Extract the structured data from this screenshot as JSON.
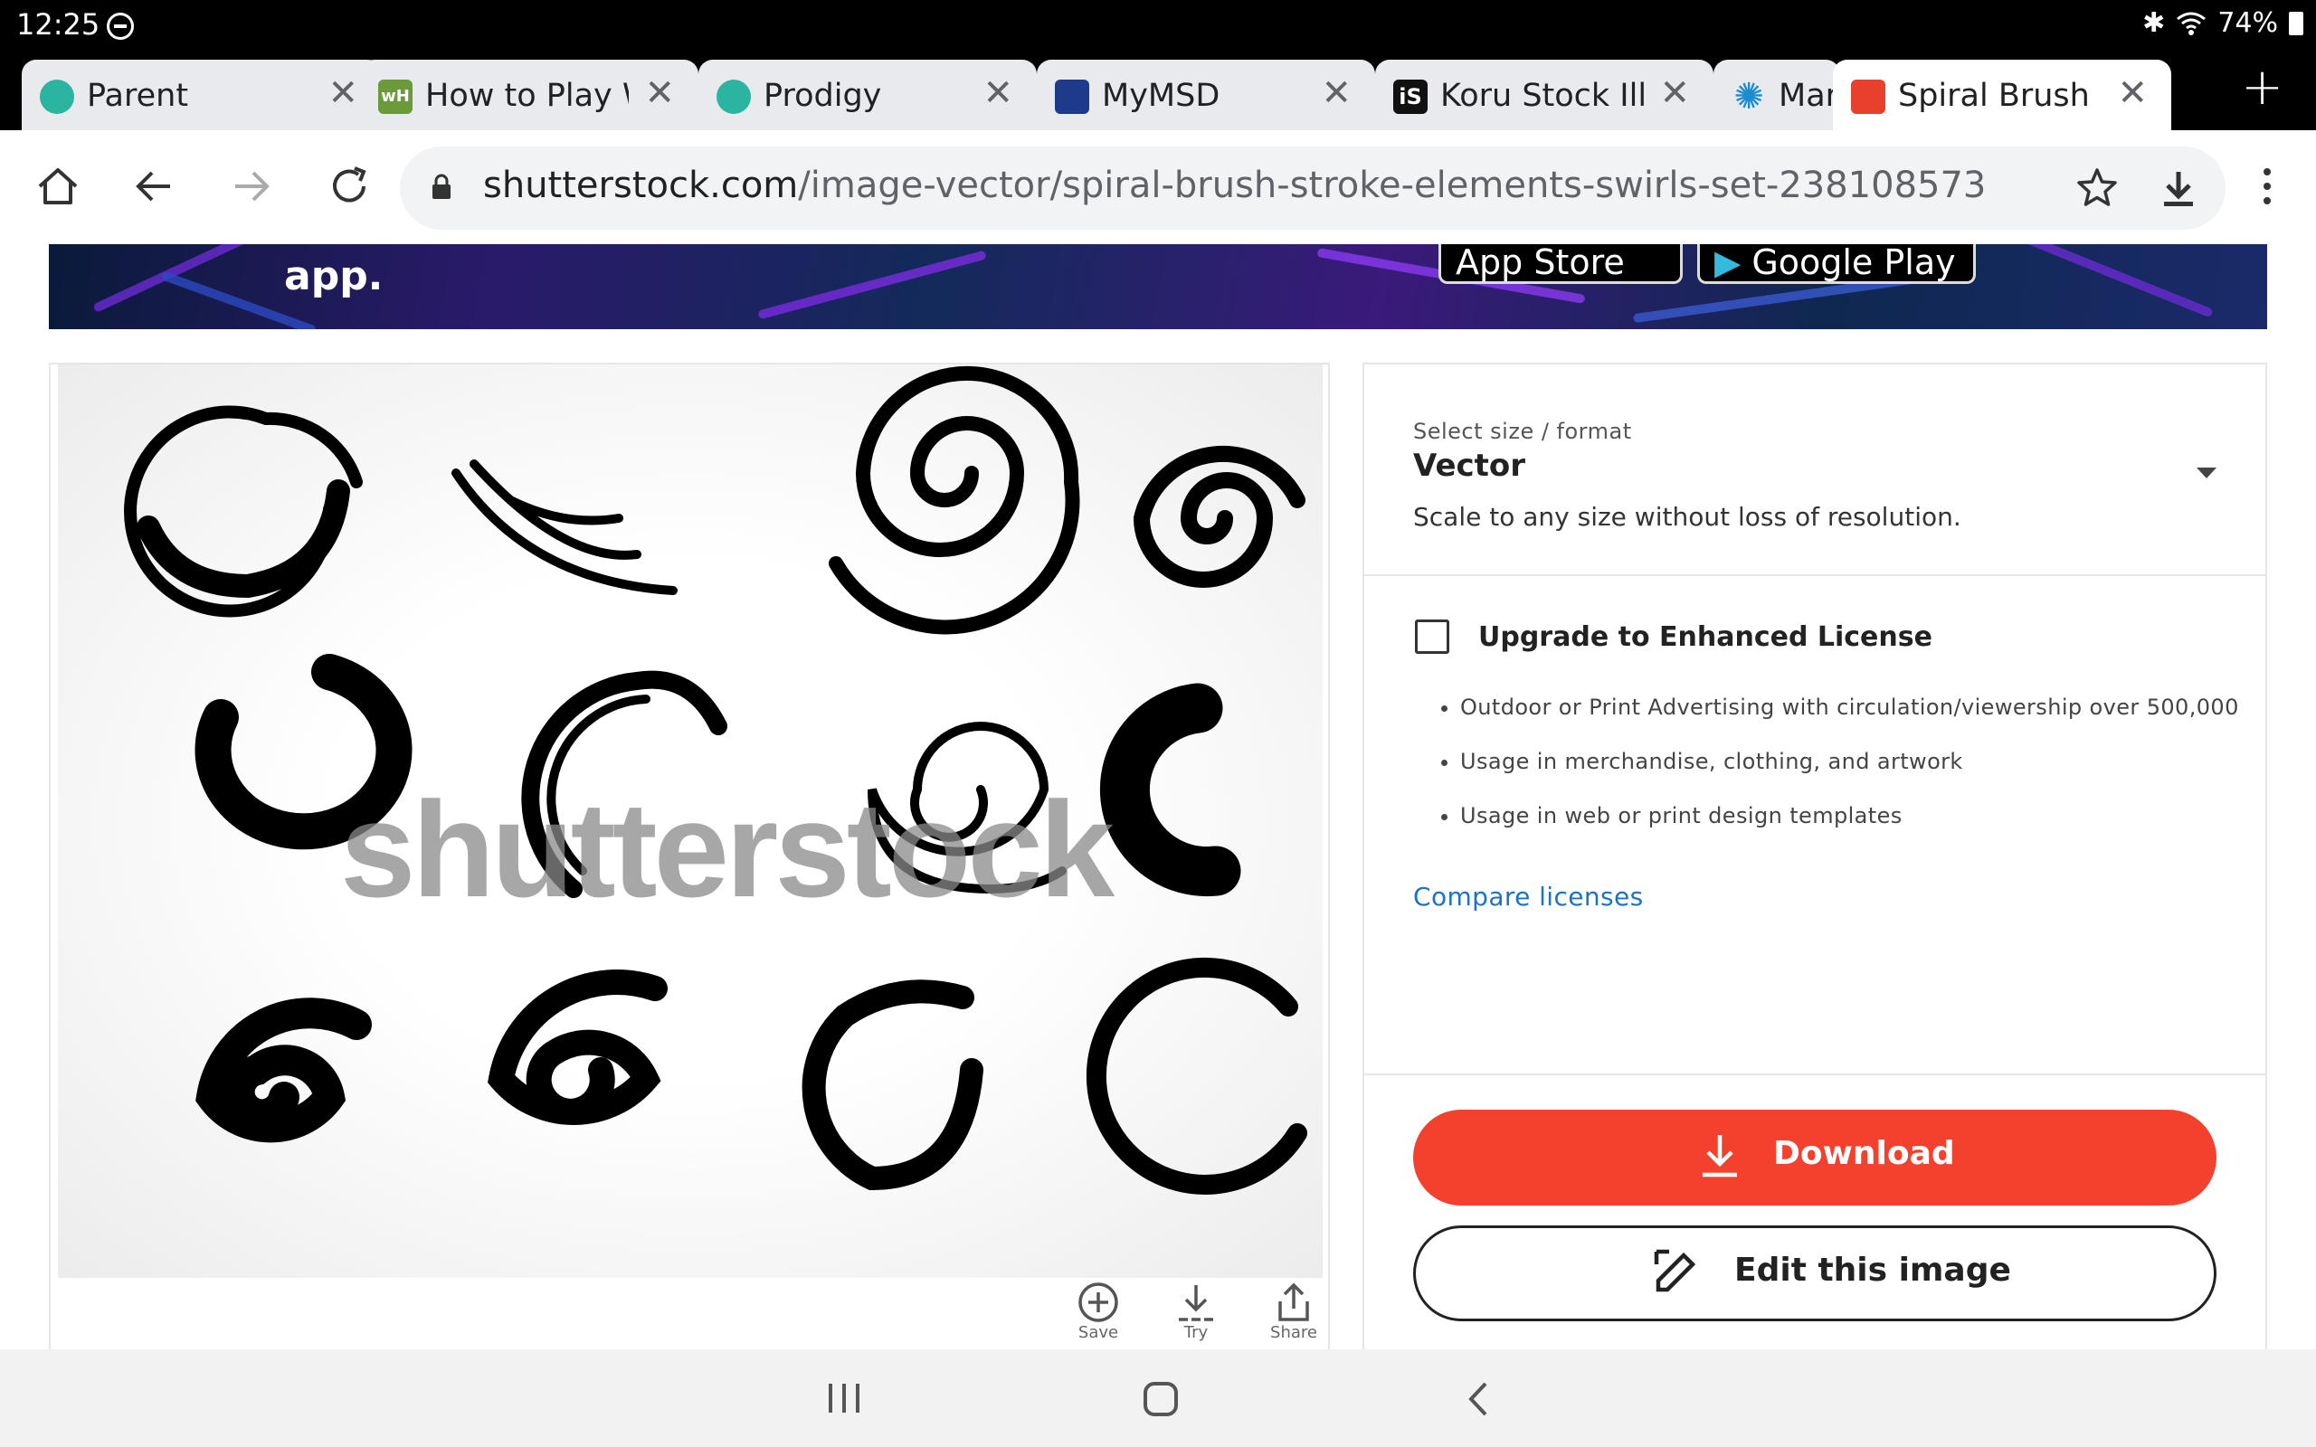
{
  "status_bar": {
    "time": "12:25",
    "battery": "74%"
  },
  "tabs": [
    {
      "title": "Parent",
      "favicon": "frog-icon",
      "color": "#2bb5a0"
    },
    {
      "title": "How to Play Wi",
      "favicon": "wh-icon",
      "color": "#6a9a3a"
    },
    {
      "title": "Prodigy",
      "favicon": "frog-icon",
      "color": "#2bb5a0"
    },
    {
      "title": "MyMSD",
      "favicon": "mymsd-icon",
      "color": "#1e3a8a"
    },
    {
      "title": "Koru Stock Illus",
      "favicon": "istock-icon",
      "color": "#111111"
    },
    {
      "title": "Mar",
      "favicon": "splash-icon",
      "color": "#1a8ccf"
    },
    {
      "title": "Spiral Brush St",
      "favicon": "shutterstock-icon",
      "color": "#e8402c"
    }
  ],
  "address_bar": {
    "domain": "shutterstock.com",
    "path": "/image-vector/spiral-brush-stroke-elements-swirls-set-238108573"
  },
  "banner": {
    "app_text": "app.",
    "app_store": "App Store",
    "google_play": "Google Play"
  },
  "watermark": "shutterstock",
  "image_actions": [
    {
      "label": "Save",
      "icon": "plus-circle-icon"
    },
    {
      "label": "Try",
      "icon": "download-dashed-icon"
    },
    {
      "label": "Share",
      "icon": "share-icon"
    }
  ],
  "license": {
    "size_label": "Select size / format",
    "format": "Vector",
    "format_desc": "Scale to any size without loss of resolution.",
    "enhanced_title": "Upgrade to Enhanced License",
    "bullets": [
      "Outdoor or Print Advertising with circulation/viewership over 500,000",
      "Usage in merchandise, clothing, and artwork",
      "Usage in web or print design templates"
    ],
    "compare_link": "Compare licenses",
    "download_label": "Download",
    "edit_label": "Edit this image"
  },
  "colors": {
    "accent": "#f4412e",
    "link": "#1a73c6"
  }
}
